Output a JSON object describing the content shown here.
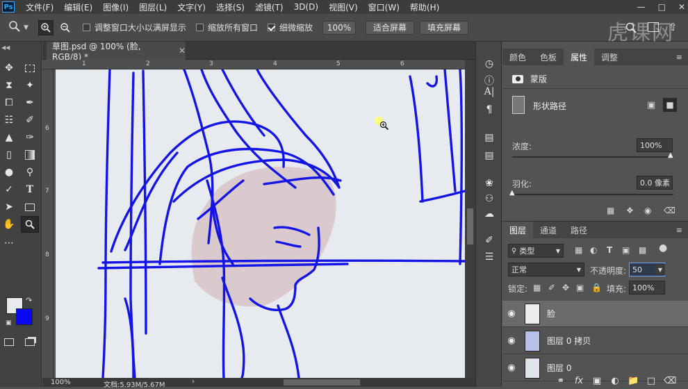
{
  "menubar": {
    "logo": "Ps",
    "items": [
      "文件(F)",
      "编辑(E)",
      "图像(I)",
      "图层(L)",
      "文字(Y)",
      "选择(S)",
      "滤镜(T)",
      "3D(D)",
      "视图(V)",
      "窗口(W)",
      "帮助(H)"
    ]
  },
  "options": {
    "resize_windows_label": "调整窗口大小以满屏显示",
    "zoom_all_label": "缩放所有窗口",
    "scrubby_zoom_label": "细微缩放",
    "zoom_value": "100%",
    "fit_screen_label": "适合屏幕",
    "fill_screen_label": "填充屏幕"
  },
  "watermark": "虎课网",
  "document": {
    "tab_title": "草图.psd @ 100% (脸, RGB/8) *",
    "ruler_top": [
      "1",
      "2",
      "3",
      "4",
      "5",
      "6"
    ],
    "ruler_left": [
      "6",
      "7",
      "8",
      "9"
    ],
    "zoom": "100%",
    "status": "文档:5.93M/5.67M"
  },
  "colors": {
    "foreground": "#e8eaee",
    "background": "#0a0af0",
    "stroke": "#1414e6",
    "skin": "#d9c7c9"
  },
  "properties": {
    "tabs": [
      "颜色",
      "色板",
      "属性",
      "调整"
    ],
    "active_tab": "属性",
    "mask_label": "蒙版",
    "shape_path_label": "形状路径",
    "density_label": "浓度:",
    "density_value": "100%",
    "feather_label": "羽化:",
    "feather_value": "0.0 像素"
  },
  "layers": {
    "tabs": [
      "图层",
      "通道",
      "路径"
    ],
    "active_tab": "图层",
    "filter_label": "类型",
    "blend_mode": "正常",
    "opacity_label": "不透明度:",
    "opacity_value": "50",
    "lock_label": "锁定:",
    "fill_label": "填充:",
    "fill_value": "100%",
    "items": [
      {
        "name": "脸",
        "visible": true,
        "selected": true
      },
      {
        "name": "图层 0 拷贝",
        "visible": true,
        "selected": false
      },
      {
        "name": "图层 0",
        "visible": true,
        "selected": false
      }
    ],
    "footer_fx": "fx"
  }
}
